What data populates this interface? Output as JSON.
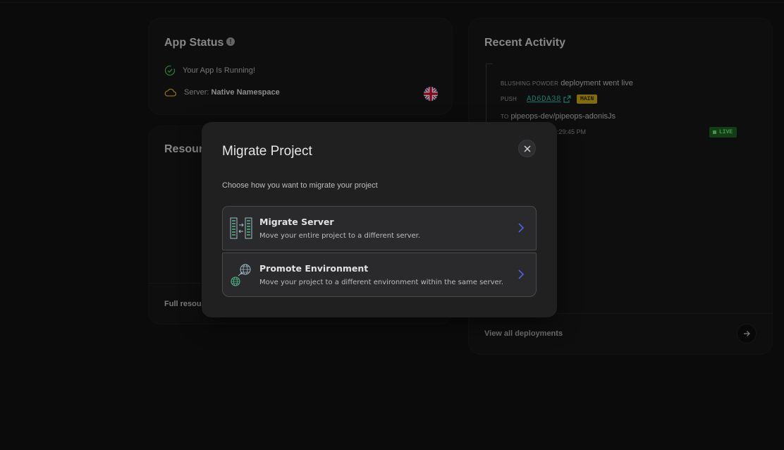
{
  "app_status": {
    "title": "App Status",
    "info_icon": "info-icon",
    "running_text": "Your App Is Running!",
    "server_label": "Server:",
    "server_value": "Native Namespace",
    "flag_icon": "uk-flag-icon"
  },
  "resources": {
    "title_partial": "Resour",
    "footer_partial": "Full resou"
  },
  "activity": {
    "title": "Recent Activity",
    "project_name": "BLUSHING POWDER",
    "event_text": "deployment went live",
    "action_label": "PUSH",
    "commit_hash": "AD6DA38",
    "branch": "MAIN",
    "to_label": "TO",
    "repo": "pipeops-dev/pipeops-adonisJs",
    "time_partial": ":29:45 PM",
    "status_badge": "LIVE",
    "view_all": "View all deployments"
  },
  "modal": {
    "title": "Migrate Project",
    "description": "Choose how you want to migrate your project",
    "options": [
      {
        "title": "Migrate Server",
        "description": "Move your entire project to a different server.",
        "icon": "server-migrate-icon"
      },
      {
        "title": "Promote Environment",
        "description": "Move your project to a different environment within the same server.",
        "icon": "globe-promote-icon"
      }
    ]
  },
  "colors": {
    "background": "#111111",
    "card": "#161616",
    "modal": "#202021",
    "accent_link": "#2fb2a4",
    "branch_badge": "#c9a71a",
    "live_badge": "#1d5f24",
    "chevron": "#3b5bdb"
  }
}
